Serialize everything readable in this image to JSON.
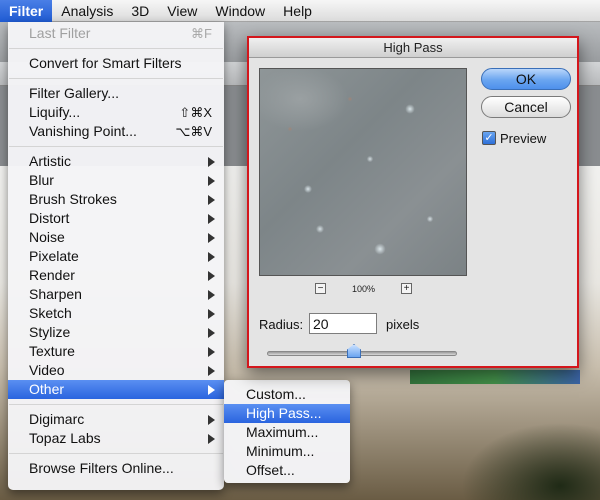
{
  "menubar": {
    "items": [
      "Filter",
      "Analysis",
      "3D",
      "View",
      "Window",
      "Help"
    ],
    "active": "Filter"
  },
  "filter_menu": {
    "last_filter": {
      "label": "Last Filter",
      "shortcut": "⌘F"
    },
    "convert": "Convert for Smart Filters",
    "filter_gallery": "Filter Gallery...",
    "liquify": {
      "label": "Liquify...",
      "shortcut": "⇧⌘X"
    },
    "vanishing_point": {
      "label": "Vanishing Point...",
      "shortcut": "⌥⌘V"
    },
    "categories": [
      "Artistic",
      "Blur",
      "Brush Strokes",
      "Distort",
      "Noise",
      "Pixelate",
      "Render",
      "Sharpen",
      "Sketch",
      "Stylize",
      "Texture",
      "Video",
      "Other"
    ],
    "plugins": [
      "Digimarc",
      "Topaz Labs"
    ],
    "browse": "Browse Filters Online..."
  },
  "other_submenu": {
    "items": [
      "Custom...",
      "High Pass...",
      "Maximum...",
      "Minimum...",
      "Offset..."
    ],
    "active": "High Pass..."
  },
  "dialog": {
    "title": "High Pass",
    "ok_label": "OK",
    "cancel_label": "Cancel",
    "preview_label": "Preview",
    "preview_checked": true,
    "zoom_minus": "−",
    "zoom_value": "100%",
    "zoom_plus": "+",
    "radius_label": "Radius:",
    "radius_value": "20",
    "radius_unit": "pixels",
    "accent_color": "#d4161c"
  }
}
